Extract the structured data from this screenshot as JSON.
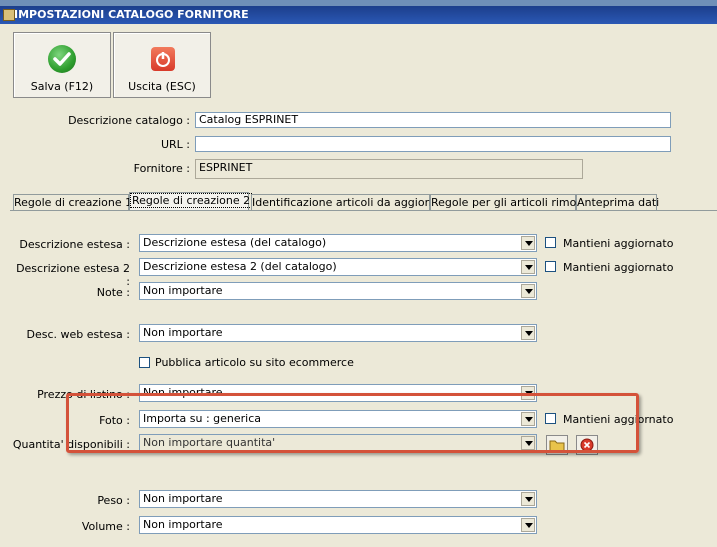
{
  "window": {
    "title": "IMPOSTAZIONI CATALOGO FORNITORE"
  },
  "toolbar": {
    "save_label": "Salva (F12)",
    "exit_label": "Uscita (ESC)"
  },
  "header": {
    "descrizione_label": "Descrizione catalogo :",
    "descrizione_value": "Catalog ESPRINET",
    "url_label": "URL :",
    "url_value": "",
    "fornitore_label": "Fornitore :",
    "fornitore_value": "ESPRINET"
  },
  "tabs": [
    {
      "label": "Regole di creazione 1"
    },
    {
      "label": "Regole di creazione 2"
    },
    {
      "label": "Identificazione articoli da aggiornare"
    },
    {
      "label": "Regole per gli articoli rimossi"
    },
    {
      "label": "Anteprima dati"
    }
  ],
  "active_tab": "Regole di creazione 2",
  "rules": {
    "descr_estesa": {
      "label": "Descrizione estesa :",
      "value": "Descrizione estesa (del catalogo)",
      "keep_label": "Mantieni aggiornato"
    },
    "descr_estesa2": {
      "label": "Descrizione estesa 2 :",
      "value": "Descrizione estesa 2 (del catalogo)",
      "keep_label": "Mantieni aggiornato"
    },
    "note": {
      "label": "Note :",
      "value": "Non importare"
    },
    "web": {
      "label": "Desc. web estesa :",
      "value": "Non importare"
    },
    "pubblica": {
      "label": "Pubblica articolo su sito ecommerce"
    },
    "prezzo": {
      "label": "Prezzo di listino :",
      "value": "Non importare"
    },
    "foto": {
      "label": "Foto :",
      "value": "Importa su : generica",
      "keep_label": "Mantieni aggiornato"
    },
    "quantita": {
      "label": "Quantita' disponibili :",
      "value": "Non importare quantita'"
    },
    "peso": {
      "label": "Peso :",
      "value": "Non importare"
    },
    "volume": {
      "label": "Volume :",
      "value": "Non importare"
    }
  },
  "colors": {
    "highlight": "#d4523a",
    "titlebar": "#1c3e8c",
    "save_icon": "#2e9e2e",
    "exit_icon": "#d83a2a"
  }
}
